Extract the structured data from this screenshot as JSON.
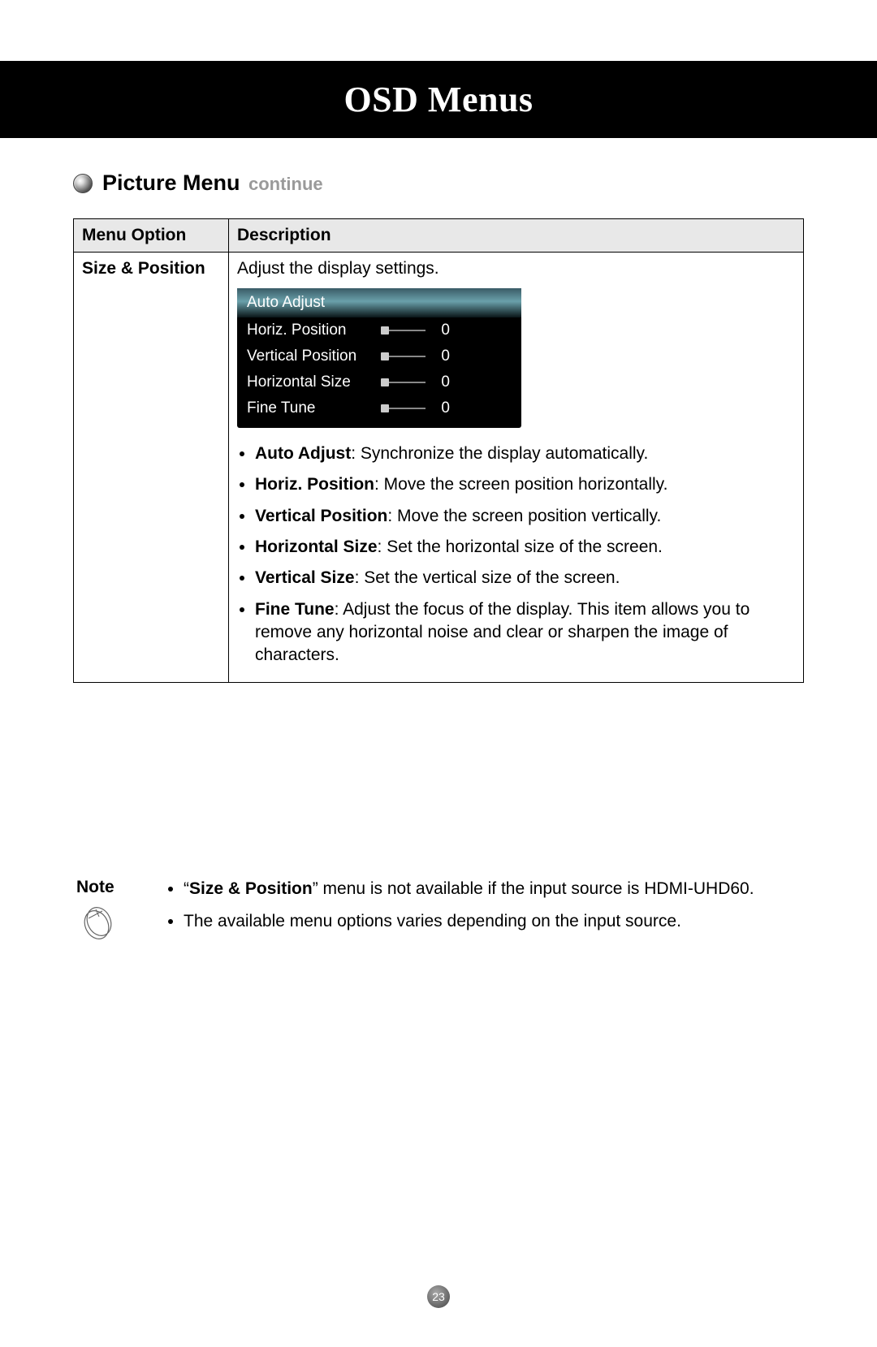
{
  "chapter_title": "OSD Menus",
  "section": {
    "title": "Picture Menu",
    "subtitle": "continue"
  },
  "table": {
    "headers": {
      "option": "Menu Option",
      "description": "Description"
    },
    "row": {
      "option": "Size & Position",
      "intro": "Adjust the display settings.",
      "osd": {
        "header": "Auto Adjust",
        "items": [
          {
            "label": "Horiz. Position",
            "value": "0"
          },
          {
            "label": "Vertical Position",
            "value": "0"
          },
          {
            "label": "Horizontal Size",
            "value": "0"
          },
          {
            "label": "Fine Tune",
            "value": "0"
          }
        ]
      },
      "bullets": [
        {
          "term": "Auto Adjust",
          "text": ": Synchronize the display automatically."
        },
        {
          "term": "Horiz. Position",
          "text": ": Move the screen position horizontally."
        },
        {
          "term": "Vertical Position",
          "text": ": Move the screen position vertically."
        },
        {
          "term": "Horizontal Size",
          "text": ": Set the horizontal size of the screen."
        },
        {
          "term": "Vertical Size",
          "text": ": Set the vertical size of the screen."
        },
        {
          "term": "Fine Tune",
          "text": ": Adjust the focus of the display. This item allows you to remove any horizontal noise and clear or sharpen the image of characters."
        }
      ]
    }
  },
  "note": {
    "label": "Note",
    "items": [
      {
        "pre": "“",
        "term": "Size & Position",
        "post": "” menu is not available if the input source is HDMI-UHD60."
      },
      {
        "pre": "",
        "term": "",
        "post": "The available menu options varies depending on the input source."
      }
    ]
  },
  "page_number": "23"
}
